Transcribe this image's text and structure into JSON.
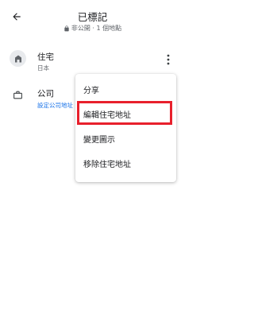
{
  "header": {
    "title": "已標記",
    "subtitle": "非公開 · 1 個地點",
    "back_icon": "arrow-back-icon",
    "lock_icon": "lock-icon"
  },
  "places": [
    {
      "title": "住宅",
      "subtitle": "日本",
      "icon": "home-icon"
    },
    {
      "title": "公司",
      "subtitle": "設定公司地址",
      "icon": "briefcase-icon"
    }
  ],
  "menu": {
    "items": [
      "分享",
      "編輯住宅地址",
      "變更圖示",
      "移除住宅地址"
    ],
    "highlighted_index": 1
  },
  "colors": {
    "link": "#1a73e8",
    "highlight_border": "#e8202c",
    "icon_gray": "#5f6368",
    "icon_circle_bg": "#e8eaed"
  }
}
